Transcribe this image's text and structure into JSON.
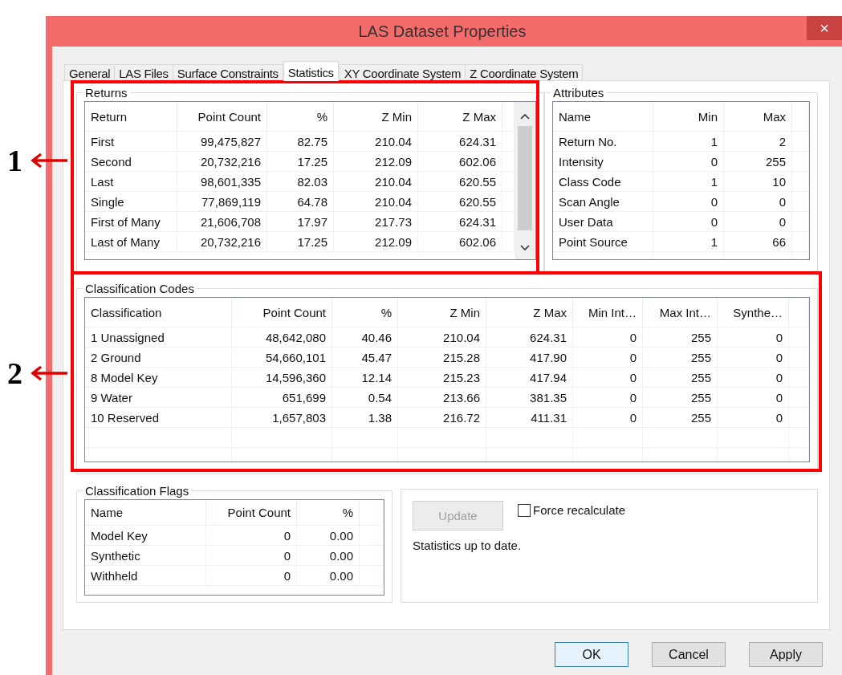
{
  "window": {
    "title": "LAS Dataset Properties",
    "close_label": "×"
  },
  "tabs": [
    {
      "label": "General",
      "selected": false
    },
    {
      "label": "LAS Files",
      "selected": false
    },
    {
      "label": "Surface Constraints",
      "selected": false
    },
    {
      "label": "Statistics",
      "selected": true
    },
    {
      "label": "XY Coordinate System",
      "selected": false
    },
    {
      "label": "Z Coordinate System",
      "selected": false
    }
  ],
  "returns": {
    "title": "Returns",
    "columns": [
      "Return",
      "Point Count",
      "%",
      "Z Min",
      "Z Max"
    ],
    "rows": [
      [
        "First",
        "99,475,827",
        "82.75",
        "210.04",
        "624.31"
      ],
      [
        "Second",
        "20,732,216",
        "17.25",
        "212.09",
        "602.06"
      ],
      [
        "Last",
        "98,601,335",
        "82.03",
        "210.04",
        "620.55"
      ],
      [
        "Single",
        "77,869,119",
        "64.78",
        "210.04",
        "620.55"
      ],
      [
        "First of Many",
        "21,606,708",
        "17.97",
        "217.73",
        "624.31"
      ],
      [
        "Last of Many",
        "20,732,216",
        "17.25",
        "212.09",
        "602.06"
      ]
    ]
  },
  "attributes": {
    "title": "Attributes",
    "columns": [
      "Name",
      "Min",
      "Max"
    ],
    "rows": [
      [
        "Return No.",
        "1",
        "2"
      ],
      [
        "Intensity",
        "0",
        "255"
      ],
      [
        "Class Code",
        "1",
        "10"
      ],
      [
        "Scan Angle",
        "0",
        "0"
      ],
      [
        "User Data",
        "0",
        "0"
      ],
      [
        "Point Source",
        "1",
        "66"
      ]
    ]
  },
  "classification_codes": {
    "title": "Classification Codes",
    "columns": [
      "Classification",
      "Point Count",
      "%",
      "Z Min",
      "Z Max",
      "Min Int…",
      "Max Int…",
      "Synthe…"
    ],
    "rows": [
      [
        "1  Unassigned",
        "48,642,080",
        "40.46",
        "210.04",
        "624.31",
        "0",
        "255",
        "0"
      ],
      [
        "2  Ground",
        "54,660,101",
        "45.47",
        "215.28",
        "417.90",
        "0",
        "255",
        "0"
      ],
      [
        "8  Model Key",
        "14,596,360",
        "12.14",
        "215.23",
        "417.94",
        "0",
        "255",
        "0"
      ],
      [
        "9  Water",
        "651,699",
        "0.54",
        "213.66",
        "381.35",
        "0",
        "255",
        "0"
      ],
      [
        "10  Reserved",
        "1,657,803",
        "1.38",
        "216.72",
        "411.31",
        "0",
        "255",
        "0"
      ]
    ]
  },
  "classification_flags": {
    "title": "Classification Flags",
    "columns": [
      "Name",
      "Point Count",
      "%"
    ],
    "rows": [
      [
        "Model Key",
        "0",
        "0.00"
      ],
      [
        "Synthetic",
        "0",
        "0.00"
      ],
      [
        "Withheld",
        "0",
        "0.00"
      ]
    ]
  },
  "update_button": {
    "label": "Update",
    "disabled": true
  },
  "force_recalculate": {
    "label": "Force recalculate",
    "checked": false
  },
  "status_text": "Statistics up to date.",
  "buttons": [
    {
      "label": "OK",
      "default": true
    },
    {
      "label": "Cancel",
      "default": false
    },
    {
      "label": "Apply",
      "default": false
    }
  ],
  "annotations": [
    {
      "number": "1"
    },
    {
      "number": "2"
    }
  ]
}
